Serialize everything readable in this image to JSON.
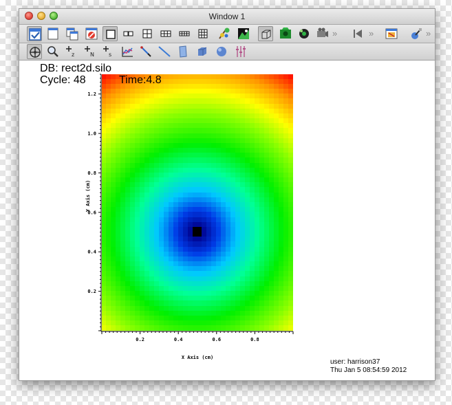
{
  "window": {
    "title": "Window 1"
  },
  "toolbar1": {
    "buttons": [
      "apply-icon",
      "new-window-icon",
      "copy-window-icon",
      "clear-window-icon",
      "layout-1x1-icon",
      "layout-1x2-icon",
      "layout-2x2-icon",
      "layout-2x3-icon",
      "layout-3x2-icon",
      "layout-3x3-icon",
      "lock-view-icon",
      "lock-time-icon",
      "view-3d-icon",
      "green-vis-icon",
      "animation-icon",
      "save-movie-icon",
      "rewind-icon",
      "macro-icon",
      "cmd-icon"
    ],
    "overflow": "»"
  },
  "toolbar2": {
    "buttons": [
      "navigate-icon",
      "zoom-icon",
      "zone-pick-icon",
      "node-pick-icon",
      "spreadsheet-pick-icon",
      "curve-pick-icon",
      "line-out-icon",
      "line-tool-icon",
      "plane-tool-icon",
      "box-tool-icon",
      "sphere-tool-icon",
      "axis-lock-icon"
    ]
  },
  "plot": {
    "db": "DB: rect2d.silo",
    "cycle": "Cycle: 48",
    "time": "Time:4.8",
    "user": "user: harrison37",
    "date": "Thu Jan  5 08:54:59 2012",
    "x_axis_title": "X Axis (cm)",
    "y_axis_title": "Y Axis (cm)",
    "x_ticks": [
      "0.2",
      "0.4",
      "0.6",
      "0.8"
    ],
    "y_ticks": [
      "0.2",
      "0.4",
      "0.6",
      "0.8",
      "1.0",
      "1.2"
    ]
  },
  "chart_data": {
    "type": "heatmap",
    "x_range": [
      0,
      1
    ],
    "y_range": [
      0,
      1.3
    ],
    "center": [
      0.5,
      0.5
    ],
    "xlabel": "X Axis (cm)",
    "ylabel": "Y Axis (cm)",
    "grid_cols": 40,
    "grid_rows": 52,
    "colormap": "hot-to-cold rainbow (black center, blue, cyan, green, yellow, red)"
  }
}
